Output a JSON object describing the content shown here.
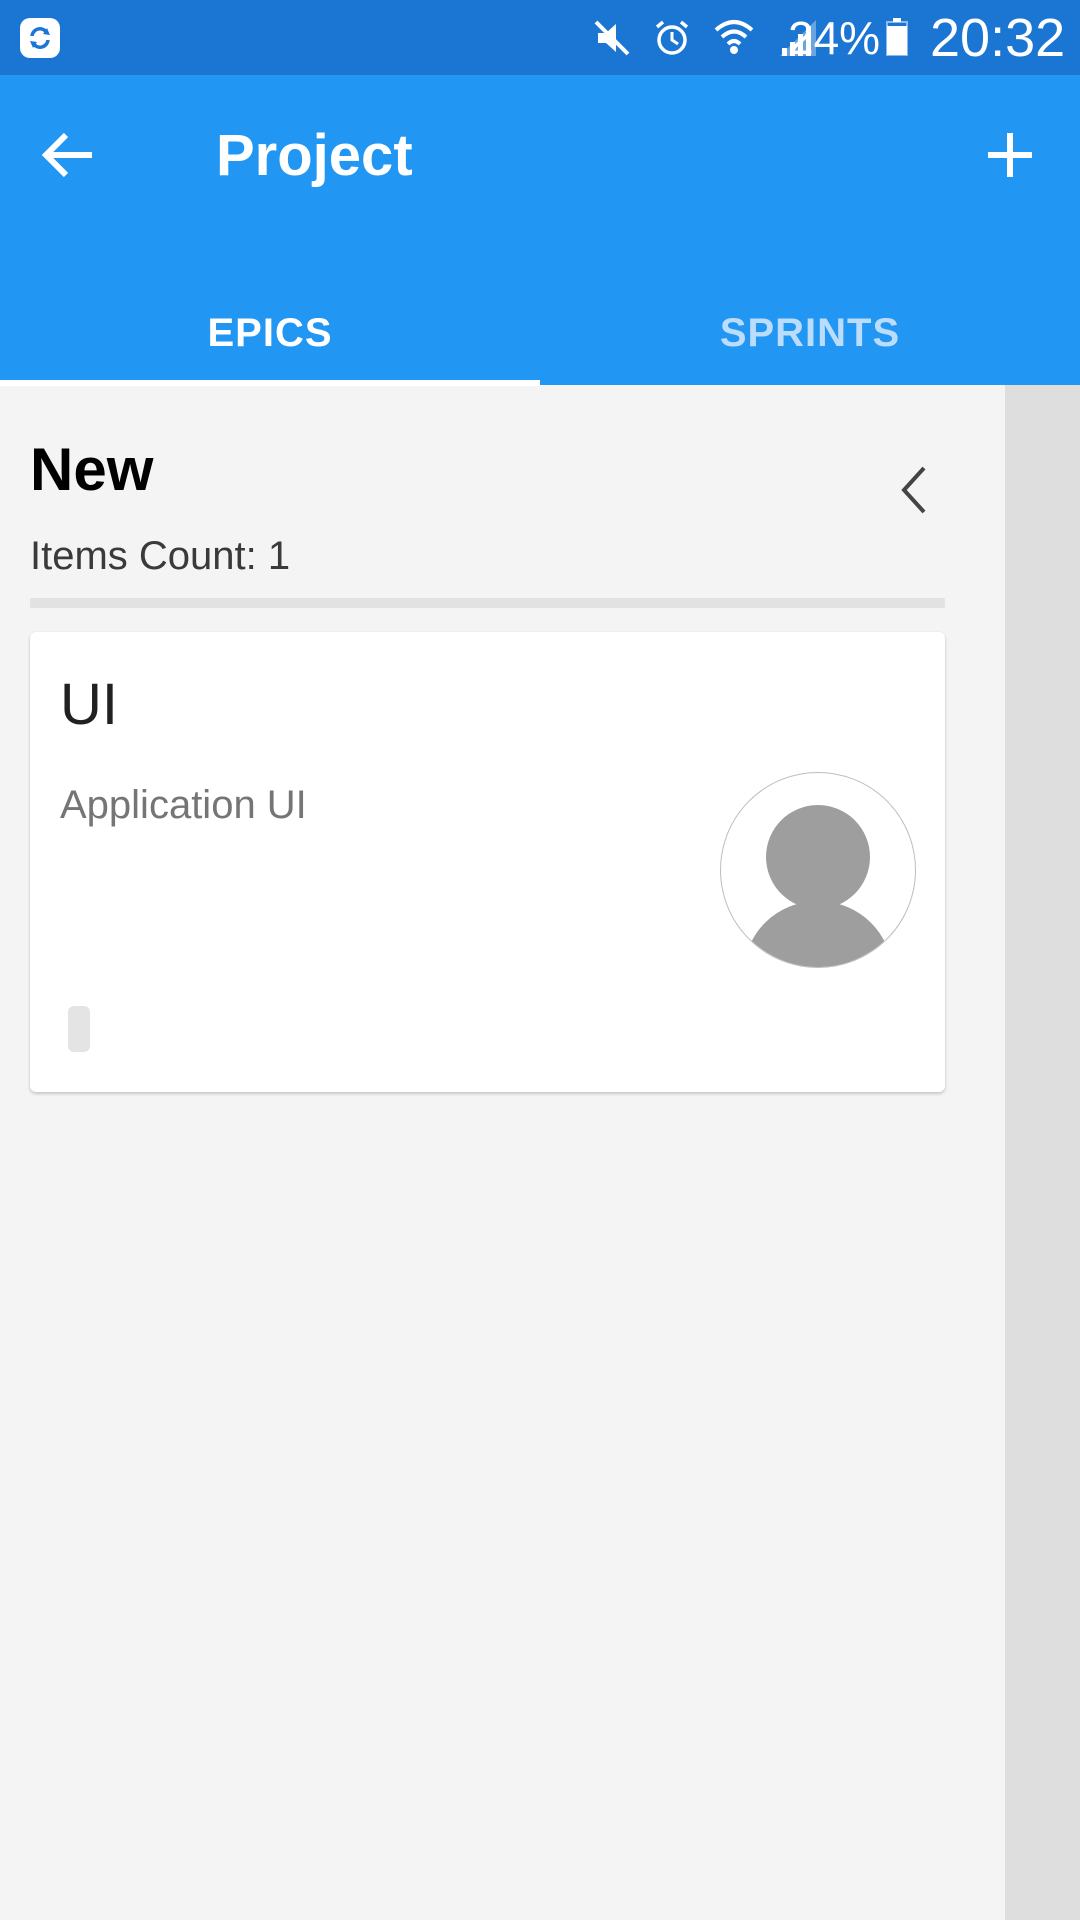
{
  "status_bar": {
    "app_icon": "sync-app-icon",
    "icons": [
      "mute-icon",
      "alarm-icon",
      "wifi-icon",
      "signal-icon"
    ],
    "battery": "24%",
    "time": "20:32",
    "colors": {
      "background": "#1b76d3",
      "text": "#ffffff"
    }
  },
  "app_bar": {
    "title": "Project",
    "back_icon": "arrow-left-icon",
    "add_icon": "plus-icon",
    "colors": {
      "background": "#2196f3",
      "text": "#ffffff"
    }
  },
  "tabs": [
    {
      "label": "EPICS",
      "selected": true
    },
    {
      "label": "SPRINTS",
      "selected": false
    }
  ],
  "column": {
    "title": "New",
    "items_count": "Items Count: 1",
    "collapse_icon": "chevron-left-icon"
  },
  "cards": [
    {
      "title": "UI",
      "description": "Application UI",
      "avatar_icon": "default-avatar-icon"
    }
  ]
}
